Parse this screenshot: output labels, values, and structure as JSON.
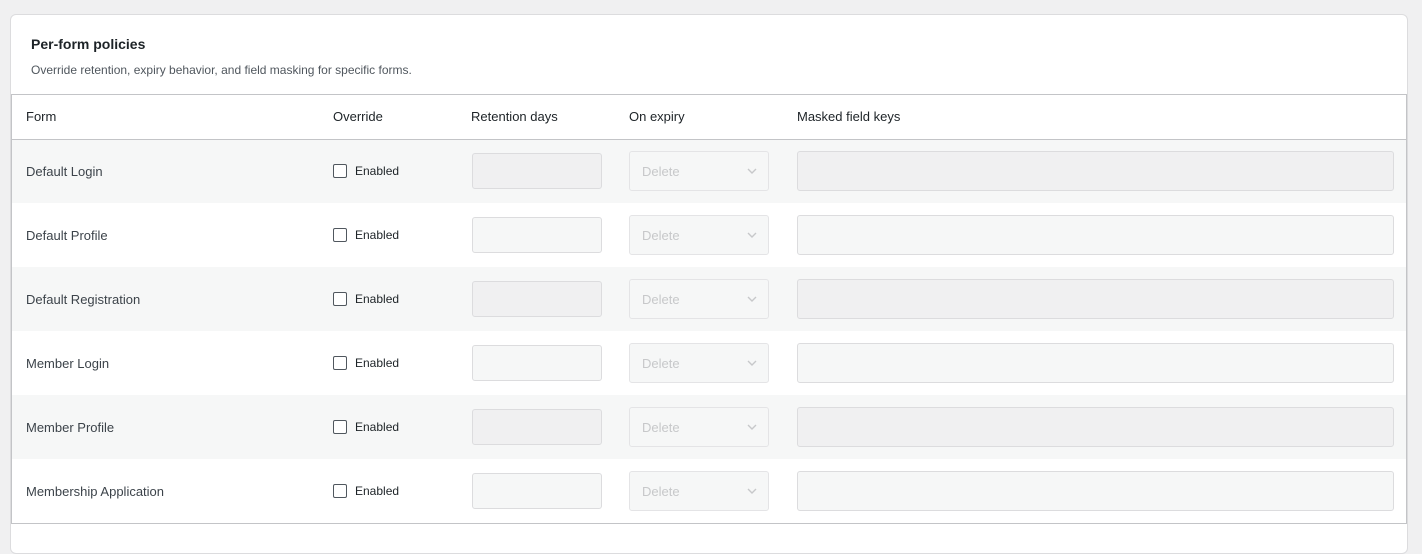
{
  "panel": {
    "title": "Per-form policies",
    "description": "Override retention, expiry behavior, and field masking for specific forms."
  },
  "table": {
    "headers": {
      "form": "Form",
      "override": "Override",
      "retention": "Retention days",
      "expiry": "On expiry",
      "masked": "Masked field keys"
    },
    "rows": [
      {
        "form": "Default Login",
        "override_label": "Enabled",
        "override_checked": false,
        "retention_days": "",
        "expiry": "Delete",
        "masked_keys": ""
      },
      {
        "form": "Default Profile",
        "override_label": "Enabled",
        "override_checked": false,
        "retention_days": "",
        "expiry": "Delete",
        "masked_keys": ""
      },
      {
        "form": "Default Registration",
        "override_label": "Enabled",
        "override_checked": false,
        "retention_days": "",
        "expiry": "Delete",
        "masked_keys": ""
      },
      {
        "form": "Member Login",
        "override_label": "Enabled",
        "override_checked": false,
        "retention_days": "",
        "expiry": "Delete",
        "masked_keys": ""
      },
      {
        "form": "Member Profile",
        "override_label": "Enabled",
        "override_checked": false,
        "retention_days": "",
        "expiry": "Delete",
        "masked_keys": ""
      },
      {
        "form": "Membership Application",
        "override_label": "Enabled",
        "override_checked": false,
        "retention_days": "",
        "expiry": "Delete",
        "masked_keys": ""
      }
    ]
  },
  "icons": {
    "select_arrow": "chevron-down-icon",
    "checkbox": "checkbox-icon"
  },
  "colors": {
    "disabled_text": "#c7c8ca",
    "row_alt": "#f6f7f7",
    "border": "#c3c4c7"
  }
}
